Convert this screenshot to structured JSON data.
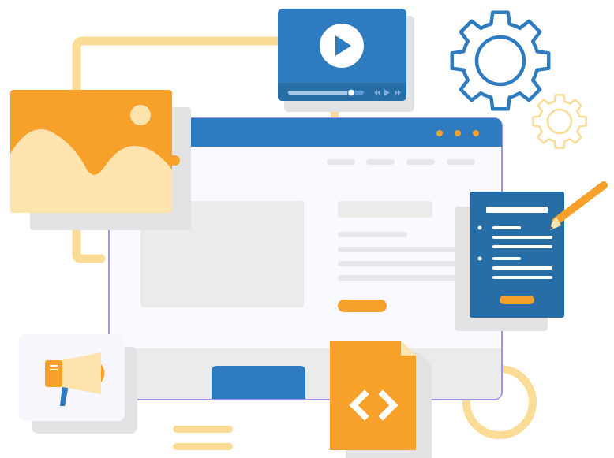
{
  "colors": {
    "blue": "#2f7bc0",
    "blue_dark": "#276ea7",
    "orange": "#f7a02a",
    "peach": "#fde3ad",
    "yellow_line": "#fadc96",
    "browser_bg": "#f9f9ff",
    "browser_border": "#9c94f0",
    "gray_block": "#ebebeb",
    "gray_line": "#e7e7ea",
    "shadow": "#e2e2e5",
    "white": "#ffffff"
  },
  "icons": [
    "browser-window-icon",
    "video-player-icon",
    "play-icon",
    "image-icon",
    "mountain-icon",
    "sun-icon",
    "gear-icon",
    "small-gear-icon",
    "document-icon",
    "pencil-icon",
    "megaphone-icon",
    "code-file-icon"
  ]
}
